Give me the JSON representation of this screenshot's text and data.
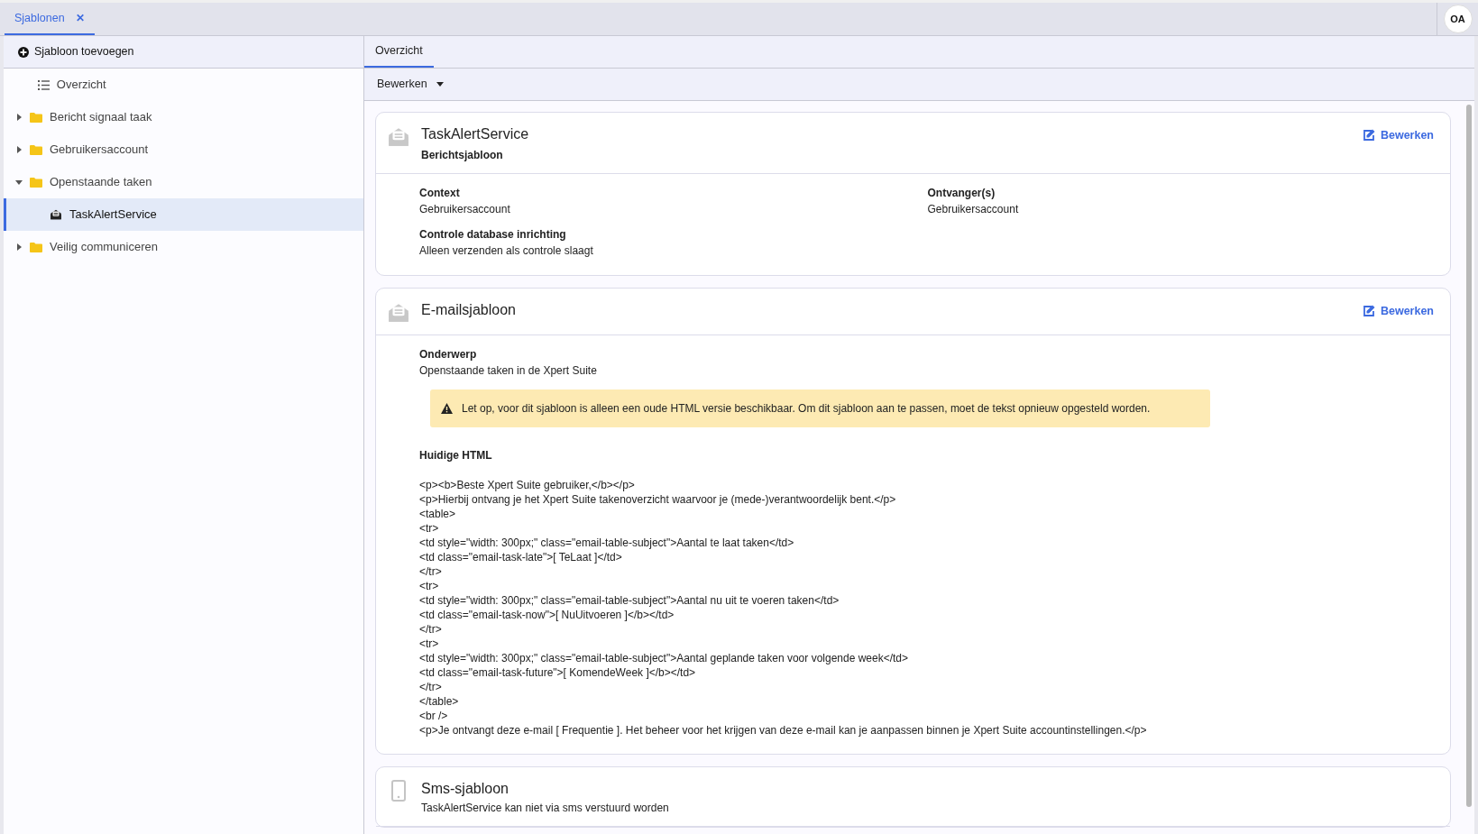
{
  "top_tabs": [
    {
      "label": "Sjablonen",
      "close": "✕",
      "selected": true
    }
  ],
  "user": {
    "initials": "OA"
  },
  "sidebar": {
    "add_button": "Sjabloon toevoegen",
    "items": [
      {
        "label": "Overzicht",
        "kind": "list",
        "selected": false
      },
      {
        "label": "Bericht signaal taak",
        "kind": "folder",
        "expanded": false,
        "selected": false
      },
      {
        "label": "Gebruikersaccount",
        "kind": "folder",
        "expanded": false,
        "selected": false
      },
      {
        "label": "Openstaande taken",
        "kind": "folder",
        "expanded": true,
        "selected": false,
        "children": [
          {
            "label": "TaskAlertService",
            "kind": "template",
            "selected": true
          }
        ]
      },
      {
        "label": "Veilig communiceren",
        "kind": "folder",
        "expanded": false,
        "selected": false
      }
    ]
  },
  "main_tabs": [
    {
      "label": "Overzicht",
      "selected": true
    }
  ],
  "toolbar": {
    "menu": "Bewerken"
  },
  "cards": [
    {
      "kind": "message",
      "title": "TaskAlertService",
      "subtitle": "Berichtsjabloon",
      "edit": "Bewerken",
      "fields": [
        {
          "label": "Context",
          "value": "Gebruikersaccount"
        },
        {
          "label": "Ontvanger(s)",
          "value": "Gebruikersaccount"
        },
        {
          "label": "Controle database inrichting",
          "value": "Alleen verzenden als controle slaagt"
        }
      ]
    },
    {
      "kind": "message",
      "title": "E-mailsjabloon",
      "edit": "Bewerken",
      "fields": [
        {
          "label": "Onderwerp",
          "value": "Openstaande taken in de Xpert Suite"
        }
      ],
      "warning": "Let op, voor dit sjabloon is alleen een oude HTML versie beschikbaar. Om dit sjabloon aan te passen, moet de tekst opnieuw opgesteld worden.",
      "html_label": "Huidige HTML",
      "html_lines": [
        "<p><b>Beste Xpert Suite gebruiker,</b></p>",
        "<p>Hierbij ontvang je het Xpert Suite takenoverzicht waarvoor je (mede-)verantwoordelijk bent.</p>",
        "<table>",
        "<tr>",
        "<td style=\"width: 300px;\" class=\"email-table-subject\">Aantal te laat taken</td>",
        "<td class=\"email-task-late\">[ TeLaat ]</td>",
        "</tr>",
        "<tr>",
        "<td style=\"width: 300px;\" class=\"email-table-subject\">Aantal nu uit te voeren taken</td>",
        "<td class=\"email-task-now\">[ NuUitvoeren ]</b></td>",
        "</tr>",
        "<tr>",
        "<td style=\"width: 300px;\" class=\"email-table-subject\">Aantal geplande taken voor volgende week</td>",
        "<td class=\"email-task-future\">[ KomendeWeek ]</b></td>",
        "</tr>",
        "</table>",
        "<br />",
        "<p>Je ontvangt deze e-mail [ Frequentie ]. Het beheer voor het krijgen van deze e-mail kan je aanpassen binnen je Xpert Suite accountinstellingen.</p>"
      ]
    },
    {
      "kind": "sms",
      "title": "Sms-sjabloon",
      "subtitle": "TaskAlertService kan niet via sms verstuurd worden"
    }
  ]
}
